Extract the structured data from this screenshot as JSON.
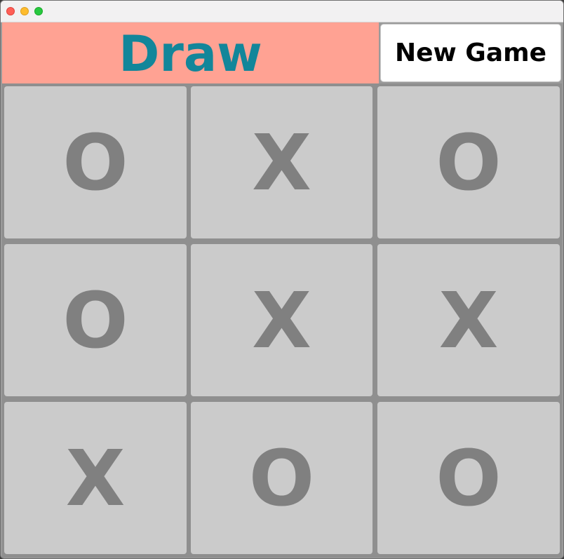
{
  "status": {
    "text": "Draw",
    "background": "#ffa293",
    "color": "#12869a"
  },
  "controls": {
    "new_game_label": "New Game"
  },
  "board": {
    "cells": [
      "O",
      "X",
      "O",
      "O",
      "X",
      "X",
      "X",
      "O",
      "O"
    ],
    "cell_background": "#cbcbcb",
    "mark_color": "#808080"
  }
}
